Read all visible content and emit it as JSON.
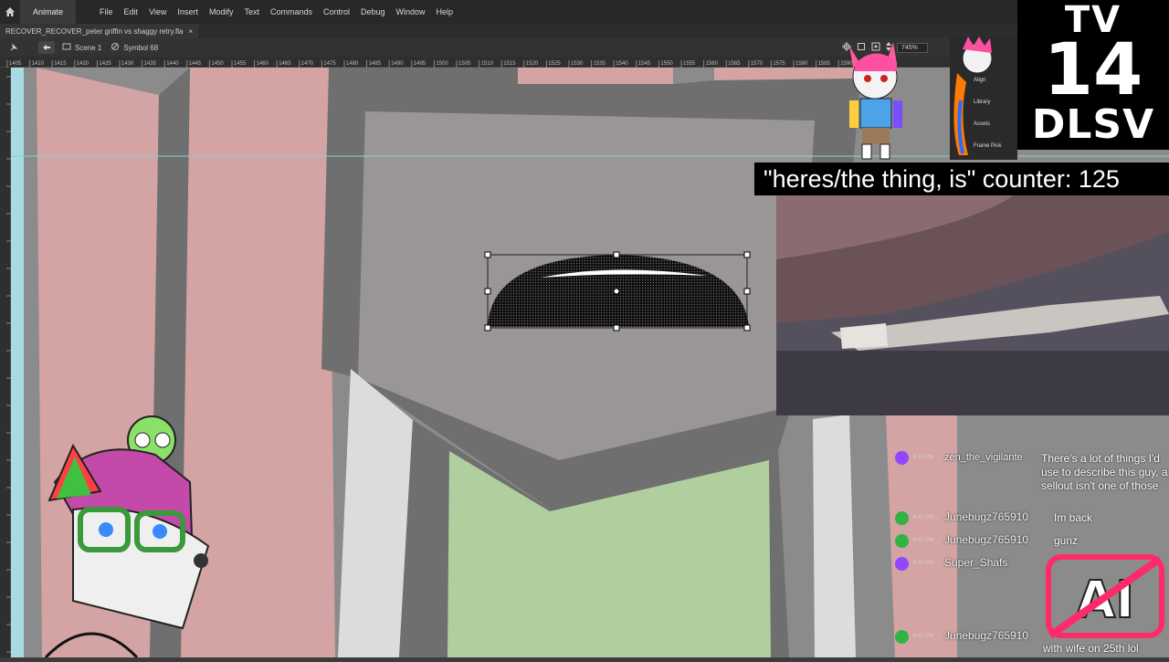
{
  "menubar": {
    "app_name": "Animate",
    "items": [
      "File",
      "Edit",
      "View",
      "Insert",
      "Modify",
      "Text",
      "Commands",
      "Control",
      "Debug",
      "Window",
      "Help"
    ]
  },
  "document": {
    "tab_title": "RECOVER_RECOVER_peter griffin vs shaggy retry.fla",
    "close_glyph": "×"
  },
  "editbar": {
    "scene_label": "Scene 1",
    "symbol_label": "Symbol 68",
    "zoom": "745%"
  },
  "ruler": {
    "labels": [
      "1405",
      "1410",
      "1415",
      "1420",
      "1425",
      "1430",
      "1435",
      "1440",
      "1445",
      "1450",
      "1455",
      "1460",
      "1465",
      "1470",
      "1475",
      "1480",
      "1485",
      "1490",
      "1495",
      "1500",
      "1505",
      "1510",
      "1515",
      "1520",
      "1525",
      "1530",
      "1535",
      "1540",
      "1545",
      "1550",
      "1555",
      "1560",
      "1565",
      "1570",
      "1575",
      "1580",
      "1585",
      "1590"
    ]
  },
  "panels": {
    "items": [
      "Align",
      "Library",
      "Assets",
      "Frame Pick"
    ]
  },
  "rating": {
    "line1": "TV",
    "line2": "14",
    "line3": "DLSV"
  },
  "counter": {
    "text": "\"heres/the thing, is\" counter: 125"
  },
  "chat": {
    "messages": [
      {
        "time": "9:41 PM",
        "user": "zen_the_vigilante",
        "text": "There's a lot of things I'd use to describe this guy, a sellout isn't one of those",
        "badge": "purple"
      },
      {
        "time": "9:41 PM",
        "user": "Junebugz765910",
        "text": "Im back",
        "badge": "green"
      },
      {
        "time": "9:42 PM",
        "user": "Junebugz765910",
        "text": "gunz",
        "badge": "green"
      },
      {
        "time": "9:42 PM",
        "user": "Super_Shafs",
        "text": "",
        "badge": "purple"
      },
      {
        "time": "9:42 PM",
        "user": "Junebugz765910",
        "text": "with wife on 25th lol",
        "badge": "green"
      }
    ]
  },
  "colors": {
    "stage_bg": "#8b8b8b",
    "pink": "#d4a3a3",
    "green": "#b1cf9e",
    "dark_gray": "#6c6c6c",
    "guide": "#7fd6d3",
    "badge_purple": "#9146ff",
    "badge_green": "#2fb344"
  }
}
